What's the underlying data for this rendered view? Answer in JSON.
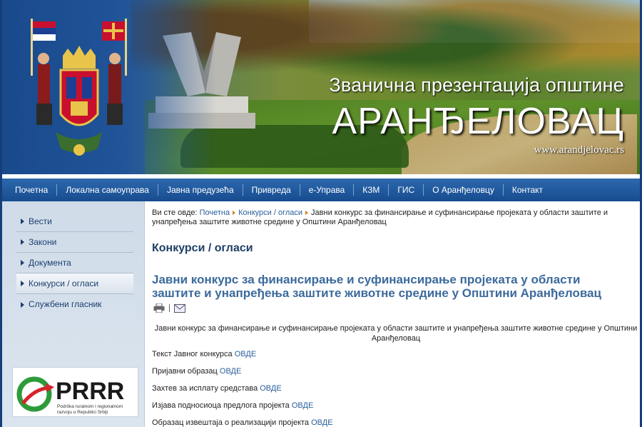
{
  "header": {
    "subtitle": "Званична презентација општине",
    "title": "АРАНЂЕЛОВАЦ",
    "url": "www.arandjelovac.rs"
  },
  "nav": {
    "items": [
      {
        "label": "Почетна"
      },
      {
        "label": "Локална самоуправа"
      },
      {
        "label": "Јавна предузећа"
      },
      {
        "label": "Привреда"
      },
      {
        "label": "е-Управа"
      },
      {
        "label": "КЗМ"
      },
      {
        "label": "ГИС"
      },
      {
        "label": "О Аранђеловцу"
      },
      {
        "label": "Контакт"
      }
    ]
  },
  "sidebar": {
    "items": [
      {
        "label": "Вести"
      },
      {
        "label": "Закони"
      },
      {
        "label": "Документа"
      },
      {
        "label": "Конкурси / огласи"
      },
      {
        "label": "Службени гласник"
      }
    ],
    "banner": {
      "logo_text": "PRRR",
      "caption_line1": "Podrška ruralnom i regionalnom",
      "caption_line2": "razvoju u Republici Srbiji"
    }
  },
  "main": {
    "breadcrumb": {
      "prefix": "Ви сте овде:",
      "home": "Почетна",
      "section": "Конкурси / огласи",
      "current": "Јавни конкурс за финансирање и суфинансирање пројеката у области заштите и унапређења заштите животне средине у Општини Аранђеловац"
    },
    "section_title": "Конкурси / огласи",
    "article_title": "Јавни конкурс за финансирање и суфинансирање пројеката у области заштите и унапређења заштите животне средине у Општини Аранђеловац",
    "intro": "Јавни конкурс за финансирање и суфинансирање пројеката у области заштите и унапређења заштите животне средине у Општини Аранђеловац",
    "documents": [
      {
        "text": "Текст Јавног конкурса",
        "link": "ОВДЕ"
      },
      {
        "text": "Пријавни образац",
        "link": "ОВДЕ"
      },
      {
        "text": "Захтев за исплату средстава",
        "link": "ОВДЕ"
      },
      {
        "text": "Изјава подносиоца предлога пројекта",
        "link": "ОВДЕ"
      },
      {
        "text": "Образац извештаја о реализацији пројекта",
        "link": "ОВДЕ"
      }
    ]
  },
  "colors": {
    "nav_bg": "#174c8f",
    "link": "#2a5f9e",
    "article_title": "#3c6a9c",
    "breadcrumb_arrow": "#d87a1a"
  }
}
